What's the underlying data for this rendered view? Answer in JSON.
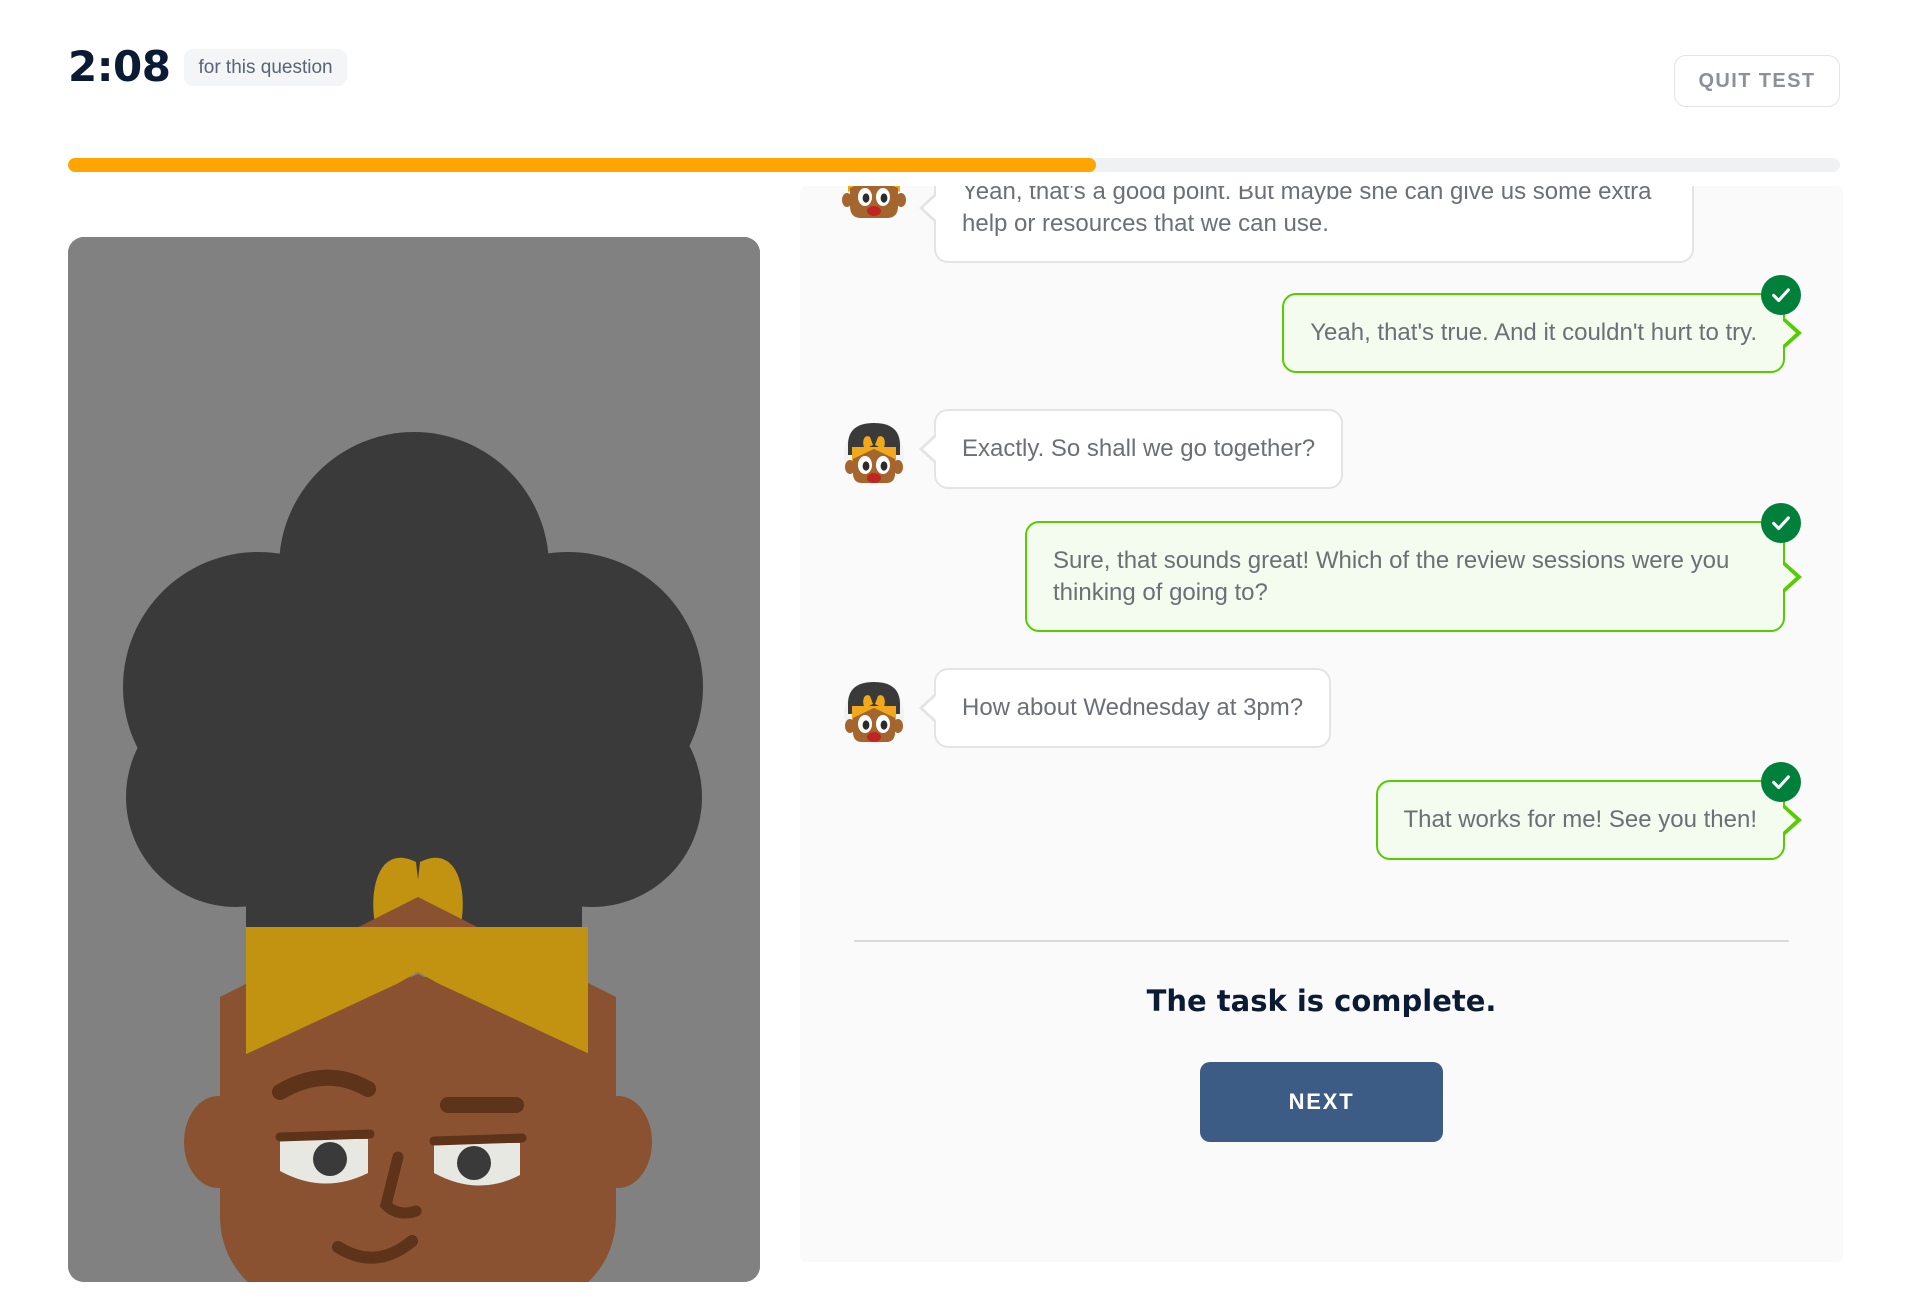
{
  "header": {
    "timer_value": "2:08",
    "timer_label": "for this question",
    "quit_label": "QUIT TEST"
  },
  "progress": {
    "percent": 58,
    "fill_color": "#ffa400",
    "track_color": "#f0f1f3"
  },
  "illustration": {
    "alt_name": "thinking-character",
    "background_color": "#818181",
    "hair_color": "#3a3a3a",
    "headband_color": "#c29211",
    "skin_color": "#6f4222",
    "face_color": "#8a5230",
    "top_color": "#c29211",
    "belt_color": "#a93226",
    "jeans_color": "#226d95"
  },
  "chat": {
    "panel_background": "#fafafa",
    "accent_green": "#58cc02",
    "badge_green": "#00803a",
    "messages": [
      {
        "side": "left",
        "speaker": "partner",
        "text": "Yeah, that's a good point. But maybe she can give us some extra help or resources that we can use.",
        "clipped": true,
        "checked": false
      },
      {
        "side": "right",
        "speaker": "you",
        "text": "Yeah, that's true. And it couldn't hurt to try.",
        "clipped": false,
        "checked": true
      },
      {
        "side": "left",
        "speaker": "partner",
        "text": "Exactly. So shall we go together?",
        "clipped": false,
        "checked": false
      },
      {
        "side": "right",
        "speaker": "you",
        "text": "Sure, that sounds great! Which of the review sessions were you thinking of going to?",
        "clipped": false,
        "checked": true
      },
      {
        "side": "left",
        "speaker": "partner",
        "text": "How about Wednesday at 3pm?",
        "clipped": false,
        "checked": false
      },
      {
        "side": "right",
        "speaker": "you",
        "text": "That works for me! See you then!",
        "clipped": false,
        "checked": true
      }
    ],
    "complete_text": "The task is complete.",
    "next_label": "NEXT"
  }
}
